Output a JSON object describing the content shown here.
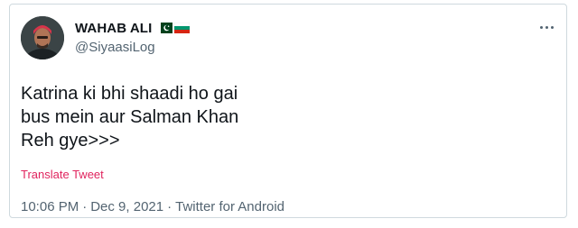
{
  "tweet": {
    "author": {
      "display_name": "WAHAB ALI",
      "handle": "@SiyaasiLog",
      "flags": [
        "pakistan-flag-icon",
        "bulgaria-flag-icon"
      ]
    },
    "text": "Katrina ki bhi shaadi ho gai\nbus mein aur Salman Khan\nReh gye>>>",
    "translate_label": "Translate Tweet",
    "time": "10:06 PM",
    "separator": "·",
    "date": "Dec 9, 2021",
    "source": "Twitter for Android"
  },
  "colors": {
    "text": "#0f1419",
    "secondary": "#536471",
    "translate": "#e0245e",
    "border": "#cfd9de"
  }
}
